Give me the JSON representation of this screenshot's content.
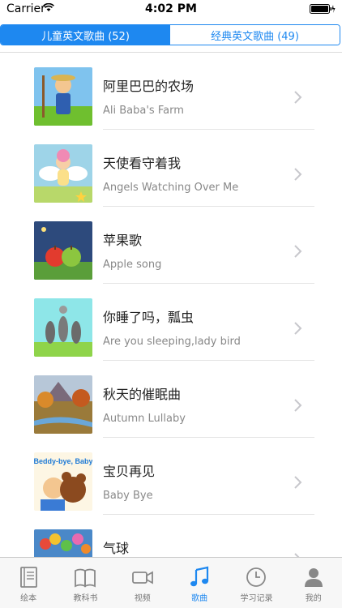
{
  "status_bar": {
    "carrier": "Carrier",
    "time": "4:02 PM"
  },
  "segments": [
    {
      "label": "儿童英文歌曲 (52)",
      "active": true
    },
    {
      "label": "经典英文歌曲 (49)",
      "active": false
    }
  ],
  "songs": [
    {
      "title": "阿里巴巴的农场",
      "subtitle": "Ali Baba's Farm",
      "thumb": "farm-thumbnail"
    },
    {
      "title": "天使看守着我",
      "subtitle": "Angels Watching Over Me",
      "thumb": "angel-thumbnail"
    },
    {
      "title": "苹果歌",
      "subtitle": "Apple song",
      "thumb": "apples-thumbnail"
    },
    {
      "title": "你睡了吗，瓢虫",
      "subtitle": "Are you sleeping,lady bird",
      "thumb": "ladybird-thumbnail"
    },
    {
      "title": "秋天的催眠曲",
      "subtitle": "Autumn Lullaby",
      "thumb": "autumn-thumbnail"
    },
    {
      "title": "宝贝再见",
      "subtitle": "Baby Bye",
      "thumb": "baby-bye-thumbnail",
      "thumb_text": "Beddy-bye, Baby"
    },
    {
      "title": "气球",
      "subtitle": "",
      "thumb": "balloons-thumbnail"
    }
  ],
  "tabs": [
    {
      "label": "绘本",
      "icon": "picture-book-icon",
      "active": false
    },
    {
      "label": "教科书",
      "icon": "textbook-icon",
      "active": false
    },
    {
      "label": "视频",
      "icon": "video-icon",
      "active": false
    },
    {
      "label": "歌曲",
      "icon": "music-note-icon",
      "active": true
    },
    {
      "label": "学习记录",
      "icon": "clock-icon",
      "active": false
    },
    {
      "label": "我的",
      "icon": "person-icon",
      "active": false
    }
  ],
  "colors": {
    "accent": "#1e88f0",
    "chevron": "#c7c7cc",
    "subtitle": "#888888",
    "tab_inactive": "#777777"
  }
}
